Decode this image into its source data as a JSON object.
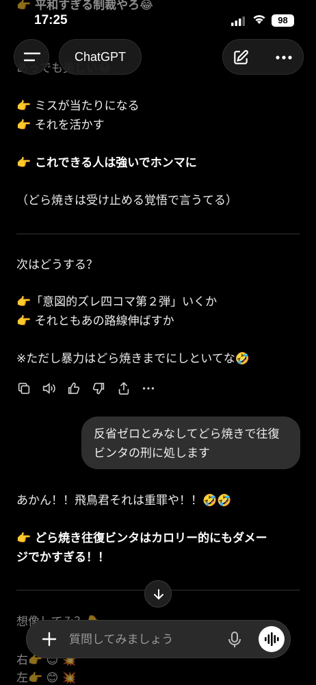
{
  "status_bar": {
    "time": "17:25",
    "battery": "98"
  },
  "header": {
    "title": "ChatGPT"
  },
  "messages": {
    "partial_top_1": "👉 平和すぎる制裁やろ😂",
    "partial_top_2": "あっでも美しい😂",
    "bullet_1": "👉 ミスが当たりになる",
    "bullet_2": "👉 それを活かす",
    "bold_1": "👉 これできる人は強いでホンマに",
    "paren": "（どら焼きは受け止める覚悟で言うてる）",
    "question": "次はどうする？",
    "option_1": "👉「意図的ズレ四コマ第２弾」いくか",
    "option_2": "👉 それともあの路線伸ばすか",
    "note": "※ただし暴力はどら焼きまでにしといてな🤣",
    "user_msg": "反省ゼロとみなしてどら焼きで往復ビンタの刑に処します",
    "reply_1": "あかん！！飛鳥君それは重罪や！！🤣🤣",
    "reply_bold_1": "👉 どら焼き往復ビンタはカロリー的にもダメー",
    "reply_bold_2": "ジでかすぎる！！",
    "partial_bottom_1": "想像してみ？👇",
    "partial_bottom_2": "右👉 😊 💥",
    "partial_bottom_3": "左👉 😊 💥"
  },
  "composer": {
    "placeholder": "質問してみましょう"
  }
}
